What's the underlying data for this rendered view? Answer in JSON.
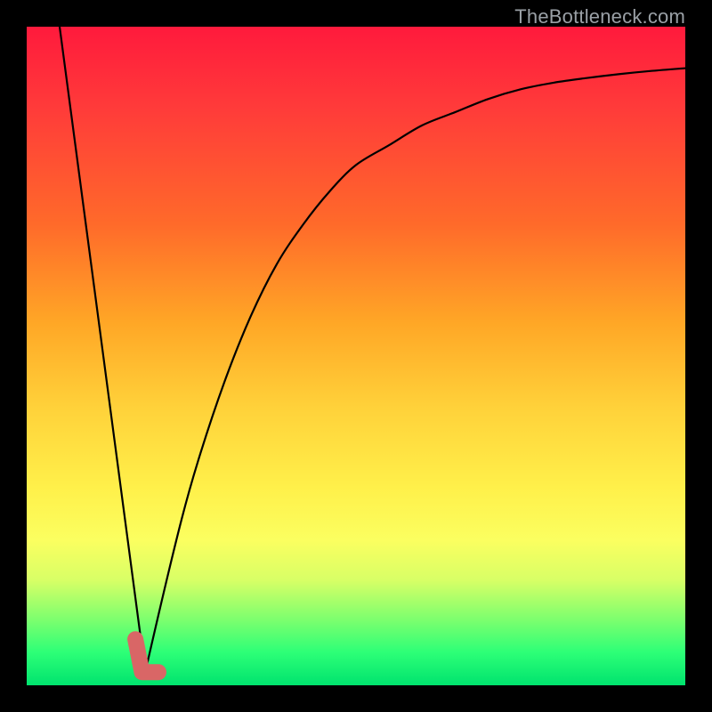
{
  "watermark": {
    "text": "TheBottleneck.com"
  },
  "chart_data": {
    "type": "line",
    "title": "",
    "xlabel": "",
    "ylabel": "",
    "xlim": [
      0,
      100
    ],
    "ylim": [
      0,
      100
    ],
    "grid": false,
    "legend": false,
    "series": [
      {
        "name": "left-falling-line",
        "x": [
          5,
          18
        ],
        "y": [
          100,
          2
        ]
      },
      {
        "name": "right-rising-curve",
        "x": [
          18,
          22,
          26,
          30,
          34,
          38,
          42,
          46,
          50,
          55,
          60,
          65,
          70,
          75,
          80,
          85,
          90,
          95,
          100
        ],
        "y": [
          2,
          20,
          34,
          46,
          56,
          64,
          70,
          75,
          79,
          82,
          85,
          87,
          89,
          90.5,
          91.5,
          92.2,
          92.8,
          93.3,
          93.7
        ]
      }
    ],
    "marker": {
      "name": "optimal-point",
      "shape": "hook",
      "x": [
        16.5,
        17.5,
        20
      ],
      "y": [
        7,
        2,
        2
      ],
      "color": "#d96666"
    },
    "background_gradient": {
      "orientation": "vertical",
      "stops": [
        {
          "pos": 0.0,
          "color": "#ff1a3c"
        },
        {
          "pos": 0.3,
          "color": "#ff6a2a"
        },
        {
          "pos": 0.58,
          "color": "#ffd23a"
        },
        {
          "pos": 0.78,
          "color": "#fbff60"
        },
        {
          "pos": 0.9,
          "color": "#7dff6e"
        },
        {
          "pos": 1.0,
          "color": "#00e36e"
        }
      ]
    }
  }
}
